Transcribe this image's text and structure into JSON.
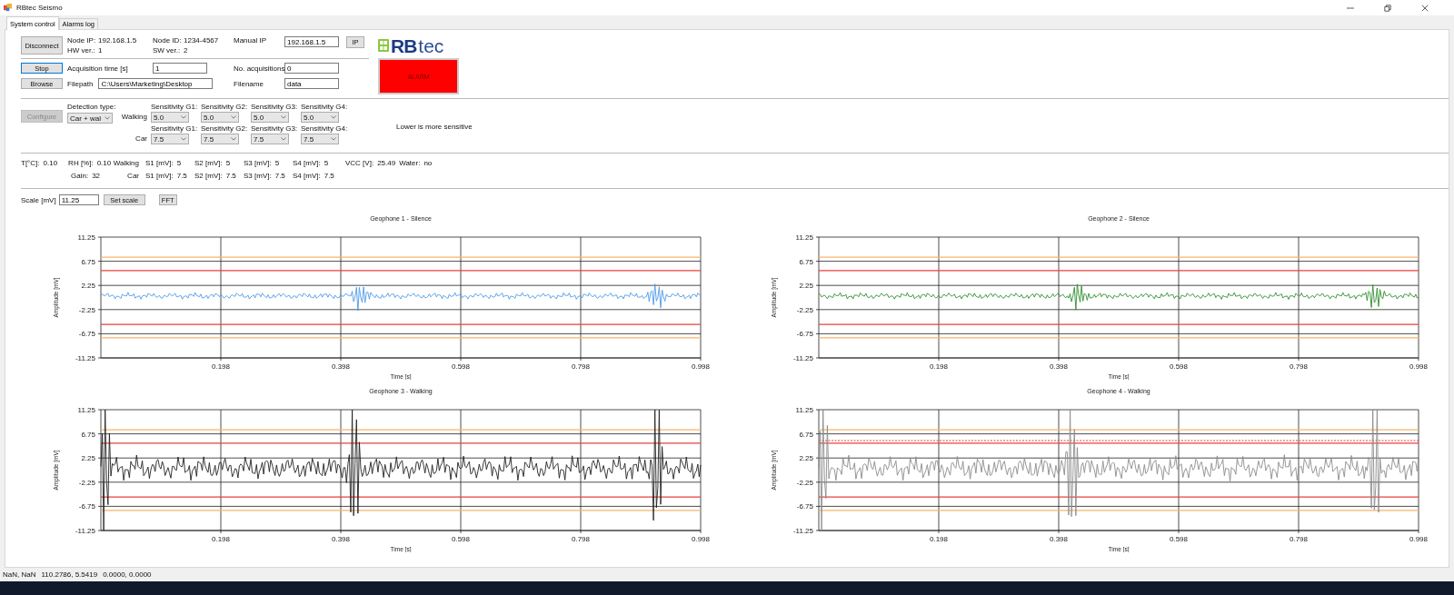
{
  "window": {
    "title": "RBtec Seismo"
  },
  "tabs": [
    {
      "label": "System control",
      "selected": true
    },
    {
      "label": "Alarms log",
      "selected": false
    }
  ],
  "connection": {
    "button": "Disconnect",
    "node_ip_label": "Node IP:",
    "node_ip": "192.168.1.5",
    "hw_label": "HW ver.:",
    "hw": "1",
    "node_id_label": "Node ID:",
    "node_id": "1234-4567",
    "sw_label": "SW ver.:",
    "sw": "2",
    "manual_ip_label": "Manual IP",
    "manual_ip": "192.168.1.5",
    "ip_button": "IP"
  },
  "logo": {
    "strong": "RB",
    "light": "tec"
  },
  "alarm": {
    "label": "ALARM",
    "active": true
  },
  "acquisition": {
    "stop_button": "Stop",
    "time_label": "Acquisition time [s]",
    "time": "1",
    "count_label": "No. acquisitions",
    "count": "0",
    "browse_button": "Browse",
    "filepath_label": "Filepath",
    "filepath": "C:\\Users\\Marketing\\Desktop",
    "filename_label": "Filename",
    "filename": "data"
  },
  "detection": {
    "configure_button": "Configure",
    "configure_disabled": true,
    "type_label": "Detection type:",
    "type": "Car + wal",
    "hint": "Lower is more sensitive",
    "rows": [
      {
        "label": "Walking",
        "sensors": [
          {
            "label": "Sensitivity G1:",
            "value": "5.0"
          },
          {
            "label": "Sensitivity G2:",
            "value": "5.0"
          },
          {
            "label": "Sensitivity G3:",
            "value": "5.0"
          },
          {
            "label": "Sensitivity G4:",
            "value": "5.0"
          }
        ]
      },
      {
        "label": "Car",
        "sensors": [
          {
            "label": "Sensitivity G1:",
            "value": "7.5"
          },
          {
            "label": "Sensitivity G2:",
            "value": "7.5"
          },
          {
            "label": "Sensitivity G3:",
            "value": "7.5"
          },
          {
            "label": "Sensitivity G4:",
            "value": "7.5"
          }
        ]
      }
    ]
  },
  "readings": {
    "environment": [
      {
        "label": "T[°C]:",
        "value": "0.10"
      },
      {
        "label": "RH [%]:",
        "value": "0.10"
      }
    ],
    "gain": {
      "label": "Gain:",
      "value": "32"
    },
    "levels": [
      {
        "label": "Walking",
        "sensors": [
          {
            "label": "S1 [mV]:",
            "value": "5"
          },
          {
            "label": "S2 [mV]:",
            "value": "5"
          },
          {
            "label": "S3 [mV]:",
            "value": "5"
          },
          {
            "label": "S4 [mV]:",
            "value": "5"
          }
        ]
      },
      {
        "label": "Car",
        "sensors": [
          {
            "label": "S1 [mV]:",
            "value": "7.5"
          },
          {
            "label": "S2 [mV]:",
            "value": "7.5"
          },
          {
            "label": "S3 [mV]:",
            "value": "7.5"
          },
          {
            "label": "S4 [mV]:",
            "value": "7.5"
          }
        ]
      }
    ],
    "supply": [
      {
        "label": "VCC [V]:",
        "value": "25.49"
      },
      {
        "label": "Water:",
        "value": "no"
      }
    ]
  },
  "scale": {
    "label": "Scale [mV]",
    "value": "11.25",
    "set_button": "Set scale",
    "fft_button": "FFT"
  },
  "charts": [
    {
      "signal": {
        "color": "#4d9be6",
        "kind": "silence"
      },
      "chart_data": {
        "type": "line",
        "title": "Geophone 1 - Silence",
        "xlabel": "Time [s]",
        "ylabel": "Amplitude [mV]",
        "xlim": [
          -0.002,
          0.998
        ],
        "ylim": [
          -11.25,
          11.25
        ],
        "grid": true,
        "xticks": [
          0.198,
          0.398,
          0.598,
          0.798,
          0.998
        ],
        "yticks": [
          11.25,
          6.75,
          2.25,
          -2.25,
          -6.75,
          -11.25
        ],
        "ref_lines": [
          {
            "axis": "y",
            "value": 7.5,
            "color": "#f7b36b"
          },
          {
            "axis": "y",
            "value": 5,
            "color": "#e8413c"
          },
          {
            "axis": "y",
            "value": -5,
            "color": "#e8413c"
          },
          {
            "axis": "y",
            "value": -7.5,
            "color": "#f7b36b"
          }
        ]
      }
    },
    {
      "signal": {
        "color": "#2f8f2f",
        "kind": "silence"
      },
      "chart_data": {
        "type": "line",
        "title": "Geophone 2 - Silence",
        "xlabel": "Time [s]",
        "ylabel": "Amplitude [mV]",
        "xlim": [
          -0.002,
          0.998
        ],
        "ylim": [
          -11.25,
          11.25
        ],
        "grid": true,
        "xticks": [
          0.198,
          0.398,
          0.598,
          0.798,
          0.998
        ],
        "yticks": [
          11.25,
          6.75,
          2.25,
          -2.25,
          -6.75,
          -11.25
        ],
        "ref_lines": [
          {
            "axis": "y",
            "value": 7.5,
            "color": "#f7b36b"
          },
          {
            "axis": "y",
            "value": 5,
            "color": "#e8413c"
          },
          {
            "axis": "y",
            "value": -5,
            "color": "#e8413c"
          },
          {
            "axis": "y",
            "value": -7.5,
            "color": "#f7b36b"
          }
        ]
      }
    },
    {
      "signal": {
        "color": "#222222",
        "kind": "walking"
      },
      "chart_data": {
        "type": "line",
        "title": "Geophone 3 - Walking",
        "xlabel": "Time [s]",
        "ylabel": "Amplitude [mV]",
        "xlim": [
          -0.002,
          0.998
        ],
        "ylim": [
          -11.25,
          11.25
        ],
        "grid": true,
        "xticks": [
          0.198,
          0.398,
          0.598,
          0.798,
          0.998
        ],
        "yticks": [
          11.25,
          6.75,
          2.25,
          -2.25,
          -6.75,
          -11.25
        ],
        "ref_lines": [
          {
            "axis": "y",
            "value": 7.5,
            "color": "#f7b36b"
          },
          {
            "axis": "y",
            "value": 5,
            "color": "#e8413c"
          },
          {
            "axis": "y",
            "value": -5,
            "color": "#e8413c"
          },
          {
            "axis": "y",
            "value": -7.5,
            "color": "#f7b36b"
          }
        ]
      }
    },
    {
      "signal": {
        "color": "#8c8c8c",
        "kind": "walking"
      },
      "chart_data": {
        "type": "line",
        "title": "Geophone 4 - Walking",
        "xlabel": "Time [s]",
        "ylabel": "Amplitude [mV]",
        "xlim": [
          -0.002,
          0.998
        ],
        "ylim": [
          -11.25,
          11.25
        ],
        "grid": true,
        "xticks": [
          0.198,
          0.398,
          0.598,
          0.798,
          0.998
        ],
        "yticks": [
          11.25,
          6.75,
          2.25,
          -2.25,
          -6.75,
          -11.25
        ],
        "ref_lines": [
          {
            "axis": "y",
            "value": 7.5,
            "color": "#f7b36b"
          },
          {
            "axis": "y",
            "value": 5.5,
            "color": "#e8413c",
            "line_style": "dashed"
          },
          {
            "axis": "y",
            "value": 5,
            "color": "#e8413c"
          },
          {
            "axis": "y",
            "value": -5,
            "color": "#e8413c"
          },
          {
            "axis": "y",
            "value": -7.5,
            "color": "#f7b36b"
          }
        ]
      }
    }
  ],
  "status_bar": [
    "NaN, NaN",
    "110.2786, 5.5419",
    "0.0000, 0.0000"
  ]
}
